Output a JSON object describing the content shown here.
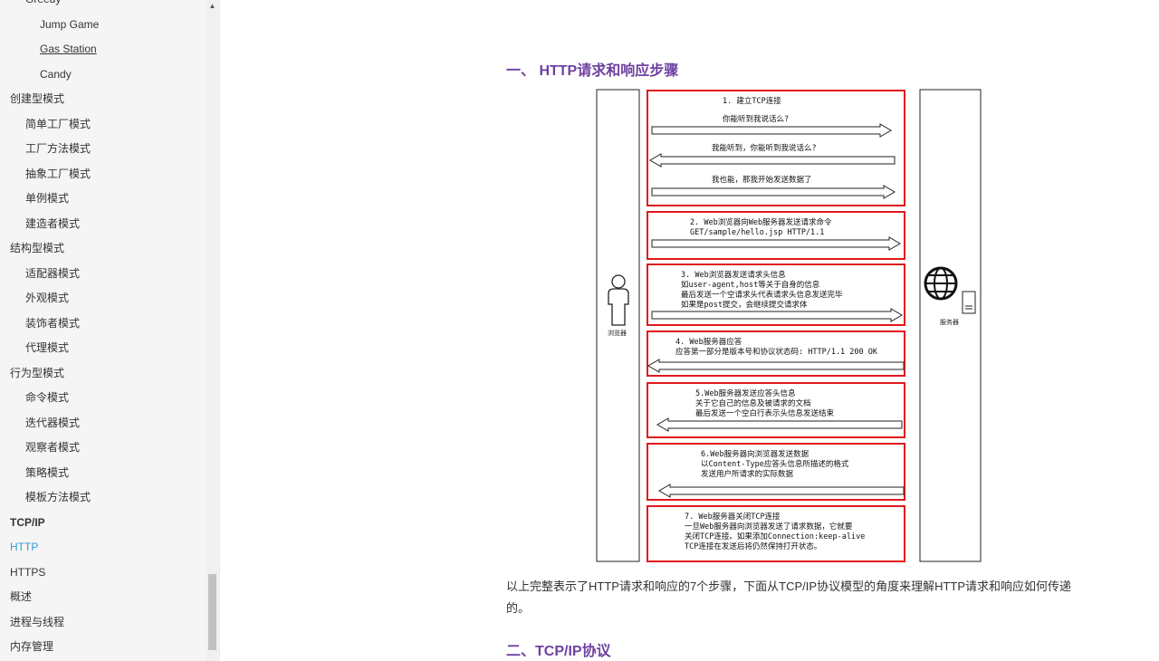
{
  "sidebar": {
    "items": [
      {
        "label": "Greedy",
        "level": 2
      },
      {
        "label": "Jump Game",
        "level": 3
      },
      {
        "label": "Gas Station",
        "level": 3
      },
      {
        "label": "Candy",
        "level": 3
      },
      {
        "label": "创建型模式",
        "level": 1
      },
      {
        "label": "简单工厂模式",
        "level": 2
      },
      {
        "label": "工厂方法模式",
        "level": 2
      },
      {
        "label": "抽象工厂模式",
        "level": 2
      },
      {
        "label": "单例模式",
        "level": 2
      },
      {
        "label": "建造者模式",
        "level": 2
      },
      {
        "label": "结构型模式",
        "level": 1
      },
      {
        "label": "适配器模式",
        "level": 2
      },
      {
        "label": "外观模式",
        "level": 2
      },
      {
        "label": "装饰者模式",
        "level": 2
      },
      {
        "label": "代理模式",
        "level": 2
      },
      {
        "label": "行为型模式",
        "level": 1
      },
      {
        "label": "命令模式",
        "level": 2
      },
      {
        "label": "迭代器模式",
        "level": 2
      },
      {
        "label": "观察者模式",
        "level": 2
      },
      {
        "label": "策略模式",
        "level": 2
      },
      {
        "label": "模板方法模式",
        "level": 2
      },
      {
        "label": "TCP/IP",
        "level": 1
      },
      {
        "label": "HTTP",
        "level": 1
      },
      {
        "label": "HTTPS",
        "level": 1
      },
      {
        "label": "概述",
        "level": 1
      },
      {
        "label": "进程与线程",
        "level": 1
      },
      {
        "label": "内存管理",
        "level": 1
      }
    ]
  },
  "main": {
    "heading1": "一、 HTTP请求和响应步骤",
    "paragraph": "以上完整表示了HTTP请求和响应的7个步骤，下面从TCP/IP协议模型的角度来理解HTTP请求和响应如何传递的。",
    "heading2": "二、TCP/IP协议"
  },
  "diagram": {
    "browser_label": "浏览器",
    "server_label": "服务器",
    "steps": [
      {
        "lines": [
          "1. 建立TCP连接"
        ],
        "arrows": [
          {
            "text": "你能听到我说话么?",
            "dir": "right"
          },
          {
            "text": "我能听到，你能听到我说话么?",
            "dir": "left"
          },
          {
            "text": "我也能，那我开始发送数据了",
            "dir": "right"
          }
        ]
      },
      {
        "lines": [
          "2. Web浏览器向Web服务器发送请求命令",
          "GET/sample/hello.jsp HTTP/1.1"
        ],
        "dir": "right"
      },
      {
        "lines": [
          "3. Web浏览器发送请求头信息",
          "如user-agent,host等关于自身的信息",
          "最后发送一个空请求头代表请求头信息发送完毕",
          "如果是post提交，会继续提交请求体"
        ],
        "dir": "right"
      },
      {
        "lines": [
          "4. Web服务器应答",
          "应答第一部分是版本号和协议状态码: HTTP/1.1 200 OK"
        ],
        "dir": "left"
      },
      {
        "lines": [
          "5.Web服务器发送应答头信息",
          "关于它自己的信息及被请求的文档",
          "最后发送一个空白行表示头信息发送结束"
        ],
        "dir": "left"
      },
      {
        "lines": [
          "6.Web服务器向浏览器发送数据",
          "以Content-Type应答头信息所描述的格式",
          "发送用户所请求的实际数据"
        ],
        "dir": "left"
      },
      {
        "lines": [
          "7. Web服务器关闭TCP连接",
          "一旦Web服务器向浏览器发送了请求数据，它就要",
          "关闭TCP连接。如果添加Connection:keep-alive",
          "TCP连接在发送后将仍然保持打开状态。"
        ],
        "dir": "none"
      }
    ]
  },
  "colors": {
    "heading": "#6f42a1",
    "active_link": "#2d9cdb",
    "step_border": "#e0191d"
  }
}
